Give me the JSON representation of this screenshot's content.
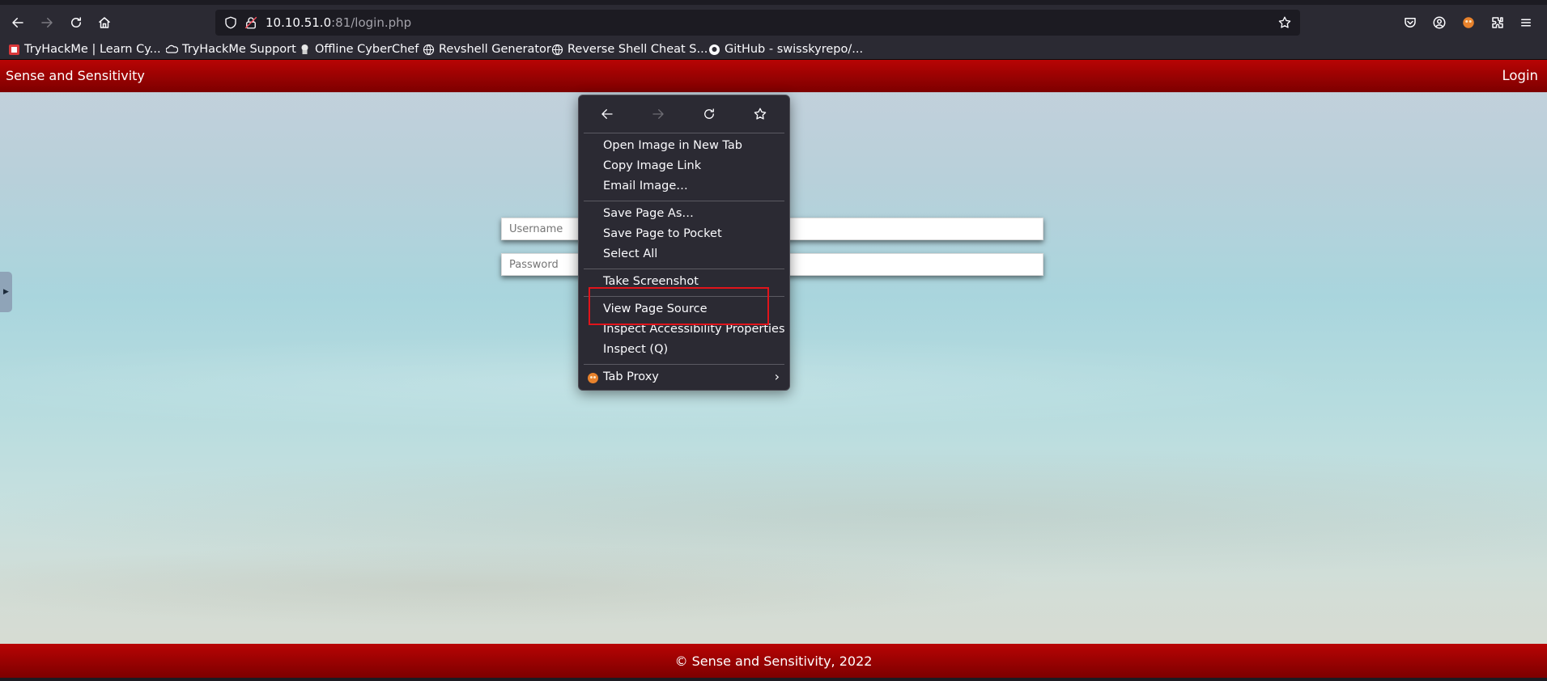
{
  "browser": {
    "url_host": "10.10.51.0",
    "url_rest": ":81/login.php",
    "bookmarks": [
      {
        "label": "TryHackMe | Learn Cy...",
        "icon": "tryhackme-icon"
      },
      {
        "label": "TryHackMe Support",
        "icon": "cloud-icon"
      },
      {
        "label": "Offline CyberChef",
        "icon": "chef-icon"
      },
      {
        "label": "Revshell Generator",
        "icon": "globe-icon"
      },
      {
        "label": "Reverse Shell Cheat S...",
        "icon": "globe-icon"
      },
      {
        "label": "GitHub - swisskyrepo/...",
        "icon": "github-icon"
      }
    ]
  },
  "site": {
    "title": "Sense and Sensitivity",
    "login_link": "Login",
    "username_placeholder": "Username",
    "password_placeholder": "Password",
    "footer": "© Sense and Sensitivity, 2022"
  },
  "context_menu": {
    "group1": [
      "Open Image in New Tab",
      "Copy Image Link",
      "Email Image…"
    ],
    "group2": [
      "Save Page As…",
      "Save Page to Pocket",
      "Select All"
    ],
    "group3": [
      "Take Screenshot"
    ],
    "group4": [
      "View Page Source",
      "Inspect Accessibility Properties",
      "Inspect (Q)"
    ],
    "group5": [
      "Tab Proxy"
    ]
  },
  "colors": {
    "header_red": "#b80404",
    "highlight_red": "#e0141b",
    "menu_bg": "#2b2a33"
  }
}
